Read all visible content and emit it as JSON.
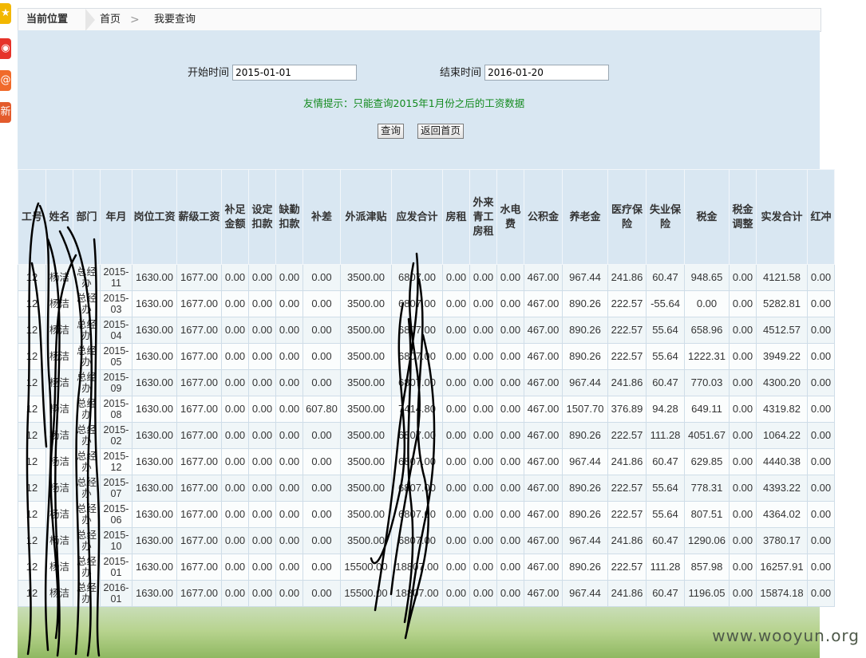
{
  "side_icons": [
    {
      "name": "star-icon",
      "glyph": "★",
      "color": "#f2b700"
    },
    {
      "name": "weibo-icon",
      "glyph": "◉",
      "color": "#e6332a"
    },
    {
      "name": "at-icon",
      "glyph": "@",
      "color": "#f06a2a"
    },
    {
      "name": "share-icon",
      "glyph": "新",
      "color": "#e35b2c"
    }
  ],
  "breadcrumb": {
    "current_label": "当前位置",
    "home": "首页",
    "page": "我要查询"
  },
  "form": {
    "start_label": "开始时间",
    "start_value": "2015-01-01",
    "end_label": "结束时间",
    "end_value": "2016-01-20",
    "tip": "友情提示：只能查询2015年1月份之后的工资数据",
    "query_button": "查询",
    "back_button": "返回首页"
  },
  "table": {
    "columns": [
      "工号",
      "姓名",
      "部门",
      "年月",
      "岗位工资",
      "薪级工资",
      "补足金额",
      "设定扣款",
      "缺勤扣款",
      "补差",
      "外派津贴",
      "应发合计",
      "房租",
      "外来青工房租",
      "水电费",
      "公积金",
      "养老金",
      "医疗保险",
      "失业保险",
      "税金",
      "税金调整",
      "实发合计",
      "红冲"
    ],
    "rows": [
      [
        "12",
        "杨洁",
        "总经办",
        "2015-11",
        "1630.00",
        "1677.00",
        "0.00",
        "0.00",
        "0.00",
        "0.00",
        "3500.00",
        "6807.00",
        "0.00",
        "0.00",
        "0.00",
        "467.00",
        "967.44",
        "241.86",
        "60.47",
        "948.65",
        "0.00",
        "4121.58",
        "0.00"
      ],
      [
        "12",
        "杨洁",
        "总经办",
        "2015-03",
        "1630.00",
        "1677.00",
        "0.00",
        "0.00",
        "0.00",
        "0.00",
        "3500.00",
        "6807.00",
        "0.00",
        "0.00",
        "0.00",
        "467.00",
        "890.26",
        "222.57",
        "-55.64",
        "0.00",
        "0.00",
        "5282.81",
        "0.00"
      ],
      [
        "12",
        "杨洁",
        "总经办",
        "2015-04",
        "1630.00",
        "1677.00",
        "0.00",
        "0.00",
        "0.00",
        "0.00",
        "3500.00",
        "6807.00",
        "0.00",
        "0.00",
        "0.00",
        "467.00",
        "890.26",
        "222.57",
        "55.64",
        "658.96",
        "0.00",
        "4512.57",
        "0.00"
      ],
      [
        "12",
        "杨洁",
        "总经办",
        "2015-05",
        "1630.00",
        "1677.00",
        "0.00",
        "0.00",
        "0.00",
        "0.00",
        "3500.00",
        "6807.00",
        "0.00",
        "0.00",
        "0.00",
        "467.00",
        "890.26",
        "222.57",
        "55.64",
        "1222.31",
        "0.00",
        "3949.22",
        "0.00"
      ],
      [
        "12",
        "杨洁",
        "总经办",
        "2015-09",
        "1630.00",
        "1677.00",
        "0.00",
        "0.00",
        "0.00",
        "0.00",
        "3500.00",
        "6807.00",
        "0.00",
        "0.00",
        "0.00",
        "467.00",
        "967.44",
        "241.86",
        "60.47",
        "770.03",
        "0.00",
        "4300.20",
        "0.00"
      ],
      [
        "12",
        "杨洁",
        "总经办",
        "2015-08",
        "1630.00",
        "1677.00",
        "0.00",
        "0.00",
        "0.00",
        "607.80",
        "3500.00",
        "7414.80",
        "0.00",
        "0.00",
        "0.00",
        "467.00",
        "1507.70",
        "376.89",
        "94.28",
        "649.11",
        "0.00",
        "4319.82",
        "0.00"
      ],
      [
        "12",
        "杨洁",
        "总经办",
        "2015-02",
        "1630.00",
        "1677.00",
        "0.00",
        "0.00",
        "0.00",
        "0.00",
        "3500.00",
        "6807.00",
        "0.00",
        "0.00",
        "0.00",
        "467.00",
        "890.26",
        "222.57",
        "111.28",
        "4051.67",
        "0.00",
        "1064.22",
        "0.00"
      ],
      [
        "12",
        "杨洁",
        "总经办",
        "2015-12",
        "1630.00",
        "1677.00",
        "0.00",
        "0.00",
        "0.00",
        "0.00",
        "3500.00",
        "6807.00",
        "0.00",
        "0.00",
        "0.00",
        "467.00",
        "967.44",
        "241.86",
        "60.47",
        "629.85",
        "0.00",
        "4440.38",
        "0.00"
      ],
      [
        "12",
        "杨洁",
        "总经办",
        "2015-07",
        "1630.00",
        "1677.00",
        "0.00",
        "0.00",
        "0.00",
        "0.00",
        "3500.00",
        "6807.00",
        "0.00",
        "0.00",
        "0.00",
        "467.00",
        "890.26",
        "222.57",
        "55.64",
        "778.31",
        "0.00",
        "4393.22",
        "0.00"
      ],
      [
        "12",
        "杨洁",
        "总经办",
        "2015-06",
        "1630.00",
        "1677.00",
        "0.00",
        "0.00",
        "0.00",
        "0.00",
        "3500.00",
        "6807.00",
        "0.00",
        "0.00",
        "0.00",
        "467.00",
        "890.26",
        "222.57",
        "55.64",
        "807.51",
        "0.00",
        "4364.02",
        "0.00"
      ],
      [
        "12",
        "杨洁",
        "总经办",
        "2015-10",
        "1630.00",
        "1677.00",
        "0.00",
        "0.00",
        "0.00",
        "0.00",
        "3500.00",
        "6807.00",
        "0.00",
        "0.00",
        "0.00",
        "467.00",
        "967.44",
        "241.86",
        "60.47",
        "1290.06",
        "0.00",
        "3780.17",
        "0.00"
      ],
      [
        "12",
        "杨洁",
        "总经办",
        "2015-01",
        "1630.00",
        "1677.00",
        "0.00",
        "0.00",
        "0.00",
        "0.00",
        "15500.00",
        "18807.00",
        "0.00",
        "0.00",
        "0.00",
        "467.00",
        "890.26",
        "222.57",
        "111.28",
        "857.98",
        "0.00",
        "16257.91",
        "0.00"
      ],
      [
        "12",
        "杨洁",
        "总经办",
        "2016-01",
        "1630.00",
        "1677.00",
        "0.00",
        "0.00",
        "0.00",
        "0.00",
        "15500.00",
        "18807.00",
        "0.00",
        "0.00",
        "0.00",
        "467.00",
        "967.44",
        "241.86",
        "60.47",
        "1196.05",
        "0.00",
        "15874.18",
        "0.00"
      ]
    ]
  },
  "watermark": "www.wooyun.org"
}
